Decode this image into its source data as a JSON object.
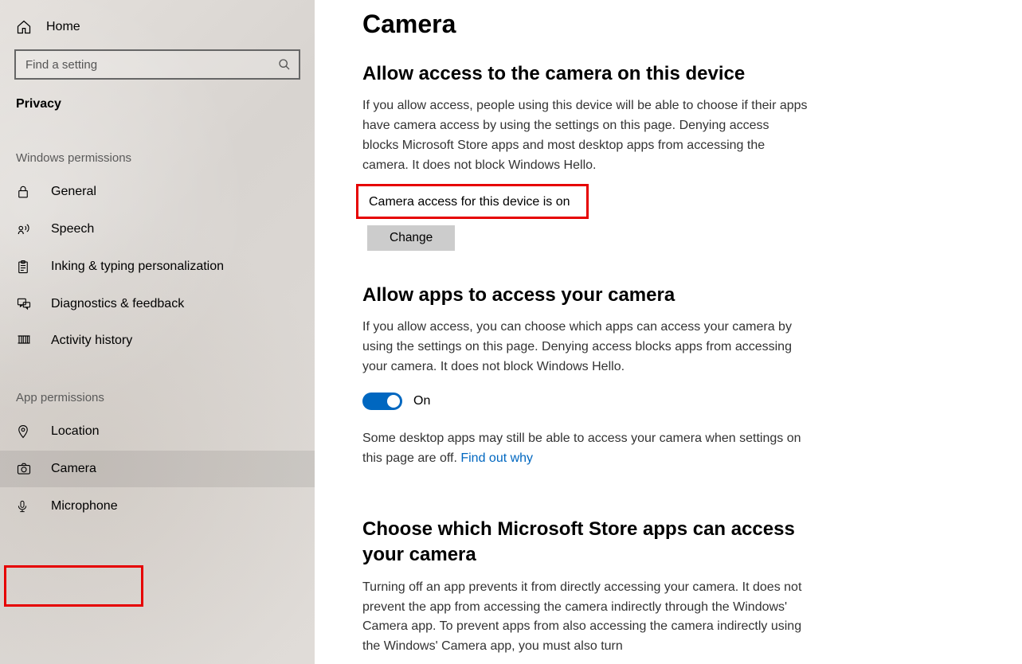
{
  "sidebar": {
    "home": "Home",
    "search_placeholder": "Find a setting",
    "category": "Privacy",
    "section_windows": "Windows permissions",
    "section_apps": "App permissions",
    "items_windows": [
      {
        "label": "General"
      },
      {
        "label": "Speech"
      },
      {
        "label": "Inking & typing personalization"
      },
      {
        "label": "Diagnostics & feedback"
      },
      {
        "label": "Activity history"
      }
    ],
    "items_apps": [
      {
        "label": "Location"
      },
      {
        "label": "Camera"
      },
      {
        "label": "Microphone"
      }
    ]
  },
  "main": {
    "title": "Camera",
    "section1": {
      "heading": "Allow access to the camera on this device",
      "desc": "If you allow access, people using this device will be able to choose if their apps have camera access by using the settings on this page. Denying access blocks Microsoft Store apps and most desktop apps from accessing the camera. It does not block Windows Hello.",
      "status": "Camera access for this device is on",
      "change_btn": "Change"
    },
    "section2": {
      "heading": "Allow apps to access your camera",
      "desc": "If you allow access, you can choose which apps can access your camera by using the settings on this page. Denying access blocks apps from accessing your camera. It does not block Windows Hello.",
      "toggle_state": "On",
      "note_pre": "Some desktop apps may still be able to access your camera when settings on this page are off. ",
      "note_link": "Find out why"
    },
    "section3": {
      "heading": "Choose which Microsoft Store apps can access your camera",
      "desc": "Turning off an app prevents it from directly accessing your camera. It does not prevent the app from accessing the camera indirectly through the Windows' Camera app. To prevent apps from also accessing the camera indirectly using the Windows' Camera app, you must also turn"
    }
  }
}
